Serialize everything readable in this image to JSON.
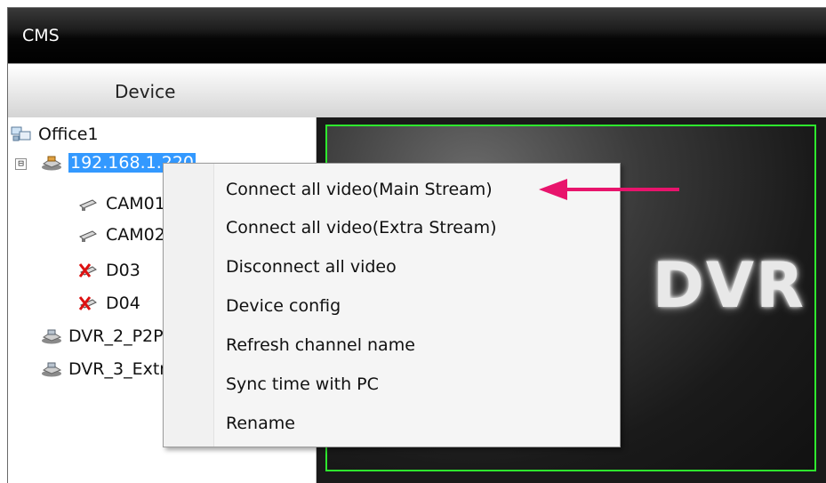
{
  "window": {
    "title": "CMS"
  },
  "tabs": {
    "device": "Device"
  },
  "tree": {
    "root": {
      "label": "Office1",
      "icon": "network-group-icon"
    },
    "device_selected": {
      "label": "192.168.1.220",
      "expander": "⊟",
      "icon": "dvr-device-icon"
    },
    "channels": [
      {
        "label": "CAM01",
        "icon": "camera-icon"
      },
      {
        "label": "CAM02",
        "icon": "camera-icon"
      },
      {
        "label": "D03",
        "icon": "camera-disconnected-icon"
      },
      {
        "label": "D04",
        "icon": "camera-disconnected-icon"
      }
    ],
    "other_devices": [
      {
        "label": "DVR_2_P2P",
        "icon": "dvr-device-icon"
      },
      {
        "label": "DVR_3_Extra",
        "icon": "dvr-device-icon"
      }
    ]
  },
  "video": {
    "logo": "DVR"
  },
  "context_menu": {
    "items": [
      "Connect all video(Main Stream)",
      "Connect all video(Extra Stream)",
      "Disconnect all video",
      "Device config",
      "Refresh channel name",
      "Sync time with PC",
      "Rename"
    ]
  },
  "annotation": {
    "arrow_color": "#e8146c",
    "icon": "pointer-arrow-icon"
  },
  "colors": {
    "selection": "#3399ff",
    "panel_border": "#2ee82e"
  }
}
